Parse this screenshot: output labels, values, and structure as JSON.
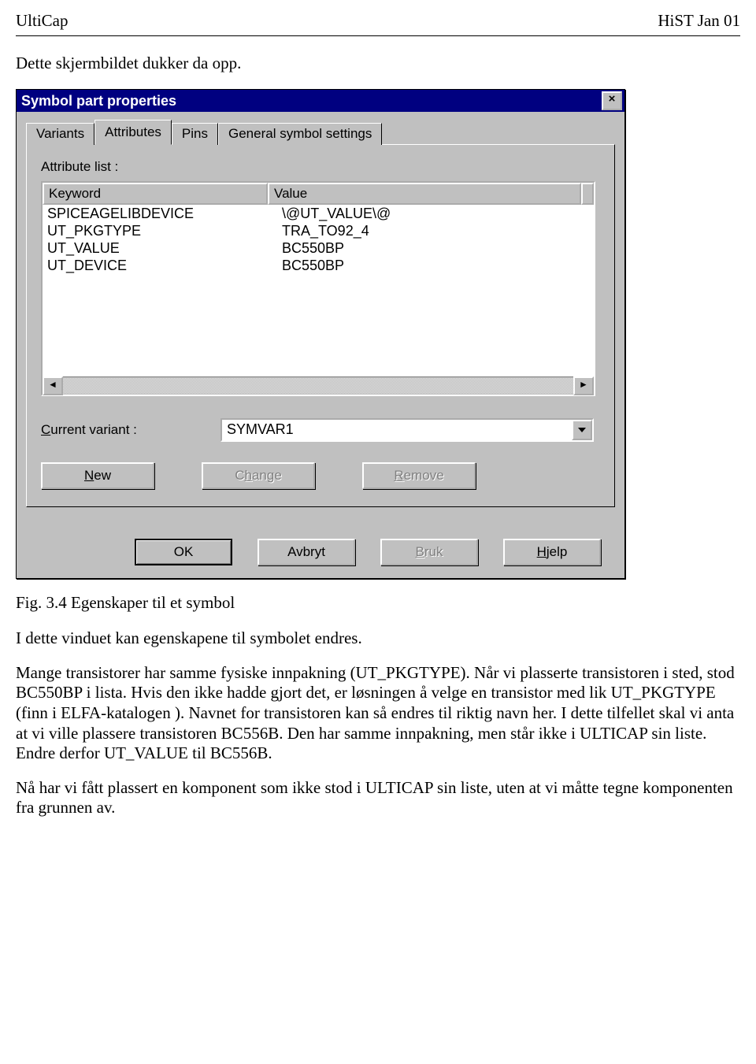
{
  "doc": {
    "header_left": "UltiCap",
    "header_right": "HiST Jan 01",
    "intro": "Dette skjermbildet dukker da opp.",
    "caption": "Fig. 3.4 Egenskaper til et symbol",
    "p1": "I dette vinduet kan egenskapene til symbolet endres.",
    "p2": "Mange transistorer har samme fysiske innpakning (UT_PKGTYPE). Når vi plasserte transistoren i sted, stod BC550BP i lista. Hvis den ikke hadde gjort det, er løsningen å velge en transistor med lik UT_PKGTYPE (finn i ELFA-katalogen ). Navnet for transistoren kan så endres til riktig navn her. I dette tilfellet skal vi anta at vi ville plassere transistoren BC556B. Den har samme innpakning, men står ikke i ULTICAP sin liste. Endre derfor UT_VALUE til BC556B.",
    "p3": "Nå har vi fått plassert en komponent som ikke stod i ULTICAP sin liste, uten at vi måtte tegne komponenten fra grunnen av."
  },
  "dialog": {
    "title": "Symbol part properties",
    "close_glyph": "×",
    "tabs": {
      "variants": "Variants",
      "attributes": "Attributes",
      "pins": "Pins",
      "general": "General symbol settings"
    },
    "attr_list_label": "Attribute list :",
    "columns": {
      "keyword": "Keyword",
      "value": "Value"
    },
    "rows": [
      {
        "keyword": "SPICEAGELIBDEVICE",
        "value": "\\@UT_VALUE\\@"
      },
      {
        "keyword": "UT_PKGTYPE",
        "value": "TRA_TO92_4"
      },
      {
        "keyword": "UT_VALUE",
        "value": "BC550BP"
      },
      {
        "keyword": "UT_DEVICE",
        "value": "BC550BP"
      }
    ],
    "current_variant_label_pre": "C",
    "current_variant_label_rest": "urrent variant :",
    "current_variant_value": "SYMVAR1",
    "scroll": {
      "left": "◄",
      "right": "►"
    },
    "buttons": {
      "new_u": "N",
      "new_rest": "ew",
      "change_pre": "C",
      "change_u": "h",
      "change_rest": "ange",
      "remove_u": "R",
      "remove_rest": "emove",
      "ok": "OK",
      "avbryt": "Avbryt",
      "bruk_u": "B",
      "bruk_rest": "ruk",
      "hjelp_u": "H",
      "hjelp_rest": "jelp"
    }
  }
}
